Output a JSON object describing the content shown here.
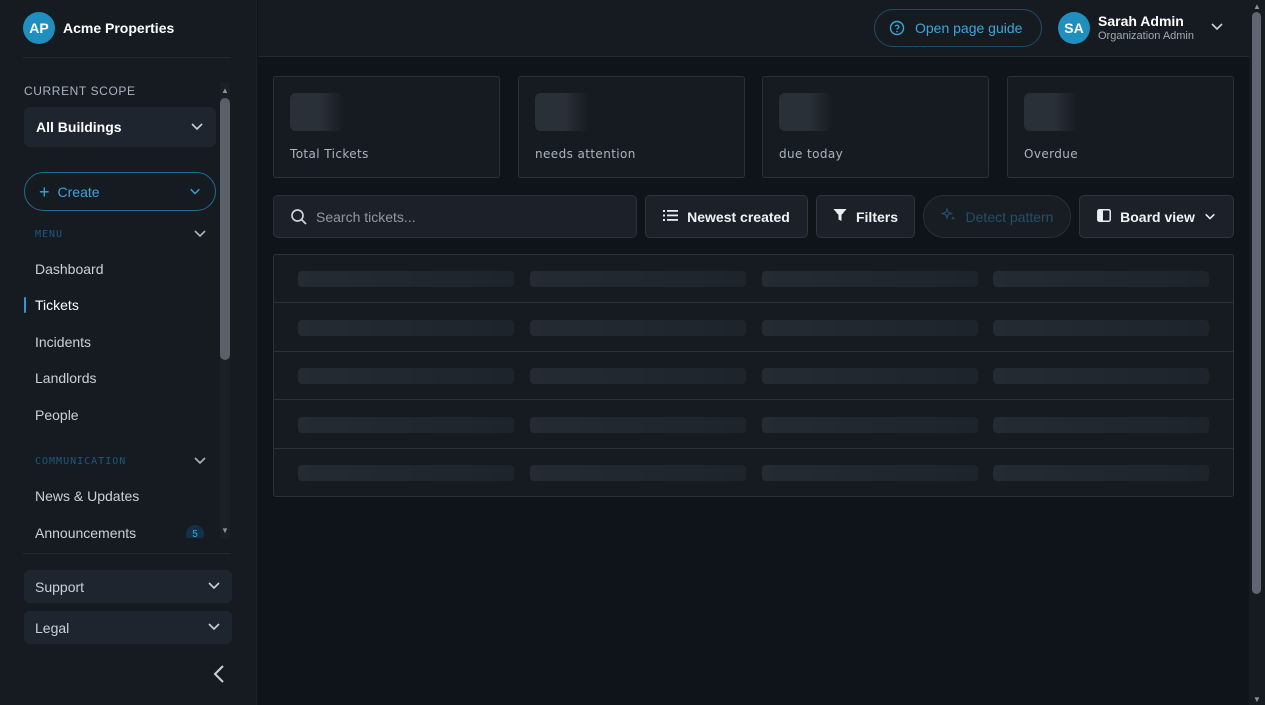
{
  "brand": {
    "initials": "AP",
    "name": "Acme Properties"
  },
  "scope": {
    "label": "CURRENT SCOPE",
    "value": "All Buildings"
  },
  "create": {
    "label": "Create"
  },
  "sections": {
    "menu": "MENU",
    "communication": "COMMUNICATION"
  },
  "nav": {
    "dashboard": "Dashboard",
    "tickets": "Tickets",
    "incidents": "Incidents",
    "landlords": "Landlords",
    "people": "People",
    "news": "News & Updates",
    "announcements": "Announcements",
    "announcements_count": "5"
  },
  "footer": {
    "support": "Support",
    "legal": "Legal"
  },
  "header": {
    "guide_label": "Open page guide",
    "user_initials": "SA",
    "user_name": "Sarah Admin",
    "user_role": "Organization Admin"
  },
  "stats": [
    {
      "label": "Total Tickets"
    },
    {
      "label": "needs attention"
    },
    {
      "label": "due today"
    },
    {
      "label": "Overdue"
    }
  ],
  "toolbar": {
    "search_placeholder": "Search tickets...",
    "sort_label": "Newest created",
    "filters_label": "Filters",
    "detect_label": "Detect pattern",
    "view_label": "Board view"
  },
  "table": {
    "loading_rows": 5,
    "loading_cols": 4
  },
  "colors": {
    "accent": "#1f8fc0",
    "accent_text": "#3aa7dc",
    "background": "#0f141b",
    "panel": "#161b22"
  }
}
